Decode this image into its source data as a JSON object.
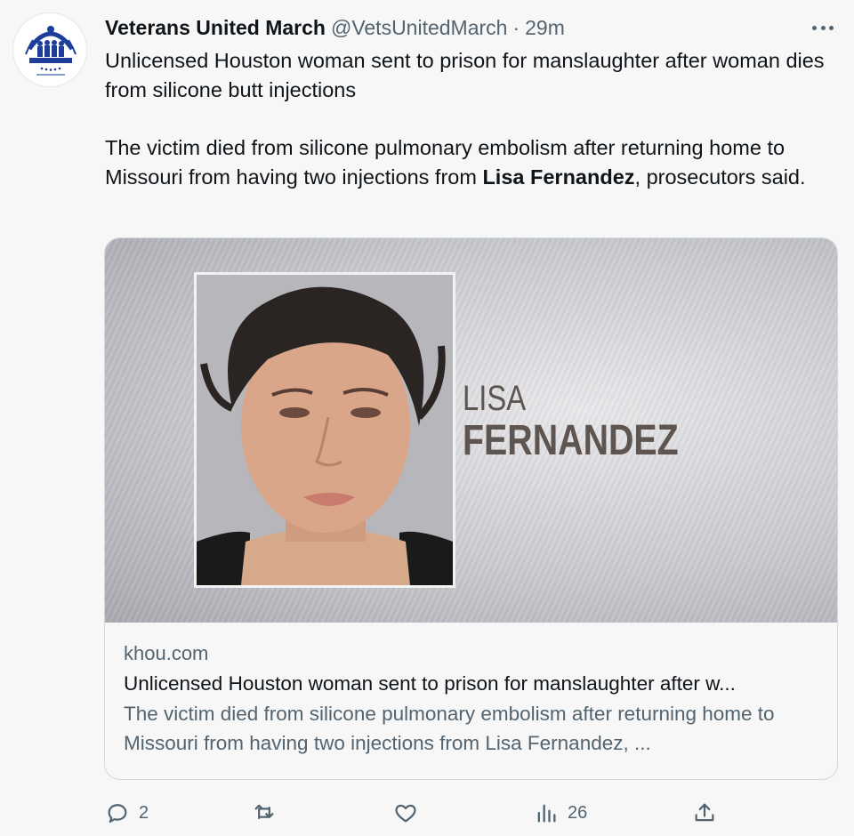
{
  "tweet": {
    "author_name": "Veterans United March",
    "author_handle": "@VetsUnitedMarch",
    "separator": "·",
    "time": "29m",
    "text_line1": "Unlicensed Houston woman sent to prison for manslaughter after woman dies from silicone butt injections",
    "text_p2_before": "The victim died from silicone pulmonary embolism after returning home to Missouri from having two injections from ",
    "text_p2_bold": "Lisa Fernandez",
    "text_p2_after": ", prosecutors said."
  },
  "card": {
    "image_first_name": "LISA",
    "image_last_name": "FERNANDEZ",
    "domain": "khou.com",
    "title": "Unlicensed Houston woman sent to prison for manslaughter after w...",
    "description": "The victim died from silicone pulmonary embolism after returning home to Missouri from having two injections from Lisa Fernandez, ..."
  },
  "actions": {
    "reply_count": "2",
    "retweet_count": "",
    "like_count": "",
    "views_count": "26"
  },
  "icons": {
    "avatar": "organization-logo",
    "more": "more-horizontal-icon",
    "reply": "reply-icon",
    "retweet": "retweet-icon",
    "like": "heart-icon",
    "views": "views-icon",
    "share": "share-icon"
  },
  "colors": {
    "text": "#0f1419",
    "secondary": "#536471",
    "border": "#cfd9de",
    "background": "#f7f7f7",
    "logo_blue": "#1d3f9a"
  }
}
